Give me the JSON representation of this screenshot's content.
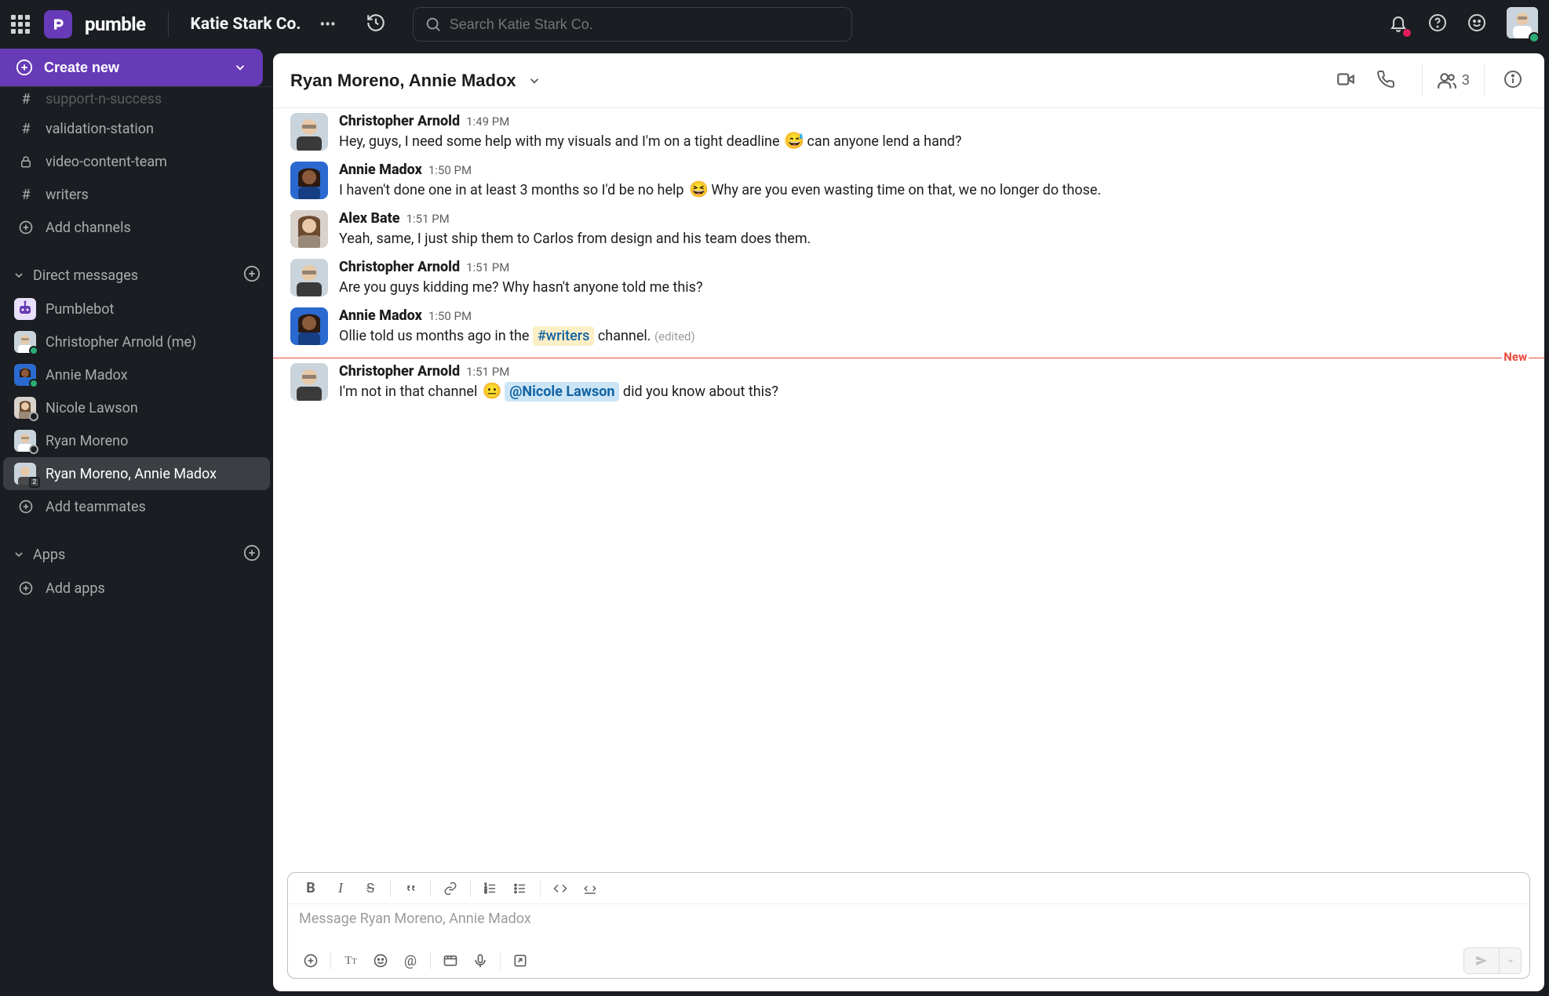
{
  "topbar": {
    "brand_text": "pumble",
    "workspace_name": "Katie Stark Co.",
    "search_placeholder": "Search Katie Stark Co."
  },
  "sidebar": {
    "create_label": "Create new",
    "channels_cut": "support-n-success",
    "channels": [
      {
        "icon": "hash",
        "label": "validation-station"
      },
      {
        "icon": "lock",
        "label": "video-content-team"
      },
      {
        "icon": "hash",
        "label": "writers"
      }
    ],
    "add_channels": "Add channels",
    "dm_header": "Direct messages",
    "dms": [
      {
        "label": "Pumblebot",
        "avatar": "bot",
        "presence": "none"
      },
      {
        "label": "Christopher Arnold (me)",
        "avatar": "male1",
        "presence": "online"
      },
      {
        "label": "Annie Madox",
        "avatar": "female1",
        "presence": "online"
      },
      {
        "label": "Nicole Lawson",
        "avatar": "female2",
        "presence": "away"
      },
      {
        "label": "Ryan Moreno",
        "avatar": "male2",
        "presence": "away"
      },
      {
        "label": "Ryan Moreno, Annie Madox",
        "avatar": "group",
        "presence": "group",
        "active": true
      }
    ],
    "add_teammates": "Add teammates",
    "apps_header": "Apps",
    "add_apps": "Add apps"
  },
  "chat_header": {
    "title": "Ryan Moreno, Annie Madox",
    "members_count": "3"
  },
  "messages": [
    {
      "avatar": "male1",
      "name": "Christopher Arnold",
      "time": "1:49 PM",
      "segments": [
        {
          "t": "text",
          "v": "Hey, guys, I need some help with my visuals and I'm on a tight deadline "
        },
        {
          "t": "emoji",
          "v": "sweat"
        },
        {
          "t": "text",
          "v": " can anyone lend a hand?"
        }
      ]
    },
    {
      "avatar": "female1",
      "name": "Annie Madox",
      "time": "1:50 PM",
      "segments": [
        {
          "t": "text",
          "v": "I haven't done one in at least 3 months so I'd be no help "
        },
        {
          "t": "emoji",
          "v": "laugh"
        },
        {
          "t": "text",
          "v": " Why are you even wasting time on that, we no longer do those."
        }
      ]
    },
    {
      "avatar": "female2",
      "name": "Alex Bate",
      "time": "1:51 PM",
      "segments": [
        {
          "t": "text",
          "v": "Yeah, same, I just ship them to Carlos from design and his team does them."
        }
      ]
    },
    {
      "avatar": "male1",
      "name": "Christopher Arnold",
      "time": "1:51 PM",
      "segments": [
        {
          "t": "text",
          "v": "Are you guys kidding me? Why hasn't anyone told me this?"
        }
      ]
    },
    {
      "avatar": "female1",
      "name": "Annie Madox",
      "time": "1:50 PM",
      "segments": [
        {
          "t": "text",
          "v": "Ollie told us months ago in the "
        },
        {
          "t": "channel",
          "v": "#writers"
        },
        {
          "t": "text",
          "v": " channel. "
        },
        {
          "t": "edited",
          "v": "(edited)"
        }
      ]
    },
    {
      "divider": "New"
    },
    {
      "avatar": "male1",
      "name": "Christopher Arnold",
      "time": "1:51 PM",
      "segments": [
        {
          "t": "text",
          "v": "I'm not in that channel "
        },
        {
          "t": "emoji",
          "v": "neutral"
        },
        {
          "t": "text",
          "v": " "
        },
        {
          "t": "mention",
          "v": "@Nicole Lawson"
        },
        {
          "t": "text",
          "v": "  did you know about this?"
        }
      ]
    }
  ],
  "composer": {
    "placeholder": "Message Ryan Moreno, Annie Madox"
  }
}
